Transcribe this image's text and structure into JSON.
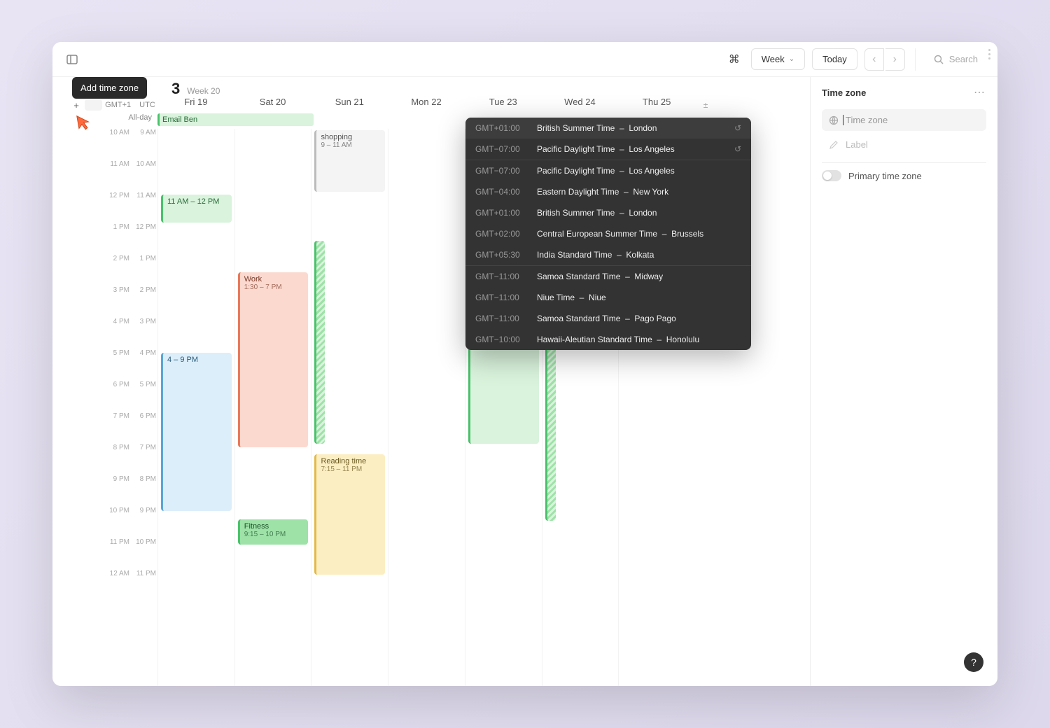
{
  "toolbar": {
    "view_label": "Week",
    "today_label": "Today",
    "search_placeholder": "Search"
  },
  "tooltip": "Add time zone",
  "date_header": {
    "day": "3",
    "week": "Week 20"
  },
  "tz_header": {
    "tz1": "GMT+1",
    "tz2": "UTC"
  },
  "allday_label": "All-day",
  "days": [
    "Fri 19",
    "Sat 20",
    "Sun 21",
    "Mon 22",
    "Tue 23",
    "Wed 24",
    "Thu 25"
  ],
  "time_labels_a": [
    "10 AM",
    "11 AM",
    "12 PM",
    "1 PM",
    "2 PM",
    "3 PM",
    "4 PM",
    "5 PM",
    "6 PM",
    "7 PM",
    "8 PM",
    "9 PM",
    "10 PM",
    "11 PM",
    "12 AM"
  ],
  "time_labels_b": [
    "9 AM",
    "10 AM",
    "11 AM",
    "12 PM",
    "1 PM",
    "2 PM",
    "3 PM",
    "4 PM",
    "5 PM",
    "6 PM",
    "7 PM",
    "8 PM",
    "9 PM",
    "10 PM",
    "11 PM"
  ],
  "allday_event": {
    "title": "Email Ben"
  },
  "events": {
    "e1": {
      "title": "11 AM – 12 PM"
    },
    "e2": {
      "title": "shopping",
      "time": "9 – 11 AM"
    },
    "e3": {
      "title": "Work",
      "time": "1:30 – 7 PM"
    },
    "e4": {
      "title": "4 – 9 PM"
    },
    "e5": {
      "title": "Reading time",
      "time": "7:15 – 11 PM"
    },
    "e6": {
      "title": "Fitness",
      "time": "9:15 – 10 PM"
    }
  },
  "dropdown": {
    "recent": [
      {
        "offset": "GMT+01:00",
        "name": "British Summer Time",
        "city": "London"
      },
      {
        "offset": "GMT−07:00",
        "name": "Pacific Daylight Time",
        "city": "Los Angeles"
      }
    ],
    "suggested": [
      {
        "offset": "GMT−07:00",
        "name": "Pacific Daylight Time",
        "city": "Los Angeles"
      },
      {
        "offset": "GMT−04:00",
        "name": "Eastern Daylight Time",
        "city": "New York"
      },
      {
        "offset": "GMT+01:00",
        "name": "British Summer Time",
        "city": "London"
      },
      {
        "offset": "GMT+02:00",
        "name": "Central European Summer Time",
        "city": "Brussels"
      },
      {
        "offset": "GMT+05:30",
        "name": "India Standard Time",
        "city": "Kolkata"
      }
    ],
    "all": [
      {
        "offset": "GMT−11:00",
        "name": "Samoa Standard Time",
        "city": "Midway"
      },
      {
        "offset": "GMT−11:00",
        "name": "Niue Time",
        "city": "Niue"
      },
      {
        "offset": "GMT−11:00",
        "name": "Samoa Standard Time",
        "city": "Pago Pago"
      },
      {
        "offset": "GMT−10:00",
        "name": "Hawaii-Aleutian Standard Time",
        "city": "Honolulu"
      }
    ]
  },
  "panel": {
    "title": "Time zone",
    "tz_placeholder": "Time zone",
    "label_placeholder": "Label",
    "primary_label": "Primary time zone"
  }
}
